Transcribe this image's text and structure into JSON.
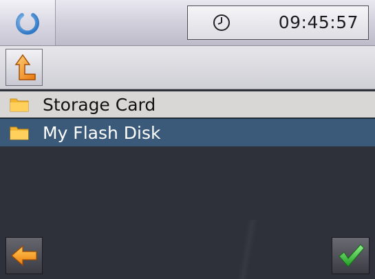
{
  "topbar": {
    "power_icon": "power-icon",
    "clock_icon": "clock-icon",
    "time": "09:45:57"
  },
  "navigation": {
    "up_icon": "folder-up-icon"
  },
  "file_list": {
    "items": [
      {
        "label": "Storage Card",
        "icon": "folder-icon",
        "selected": false
      },
      {
        "label": "My Flash Disk",
        "icon": "folder-icon",
        "selected": true
      }
    ]
  },
  "bottom_bar": {
    "back_icon": "back-arrow-icon",
    "confirm_icon": "checkmark-icon"
  },
  "colors": {
    "selected_row": "#3b5a79",
    "unselected_row": "#d8d7d6",
    "background": "#2f313a",
    "accent_orange": "#f29a1c",
    "check_green": "#2fae2f"
  }
}
